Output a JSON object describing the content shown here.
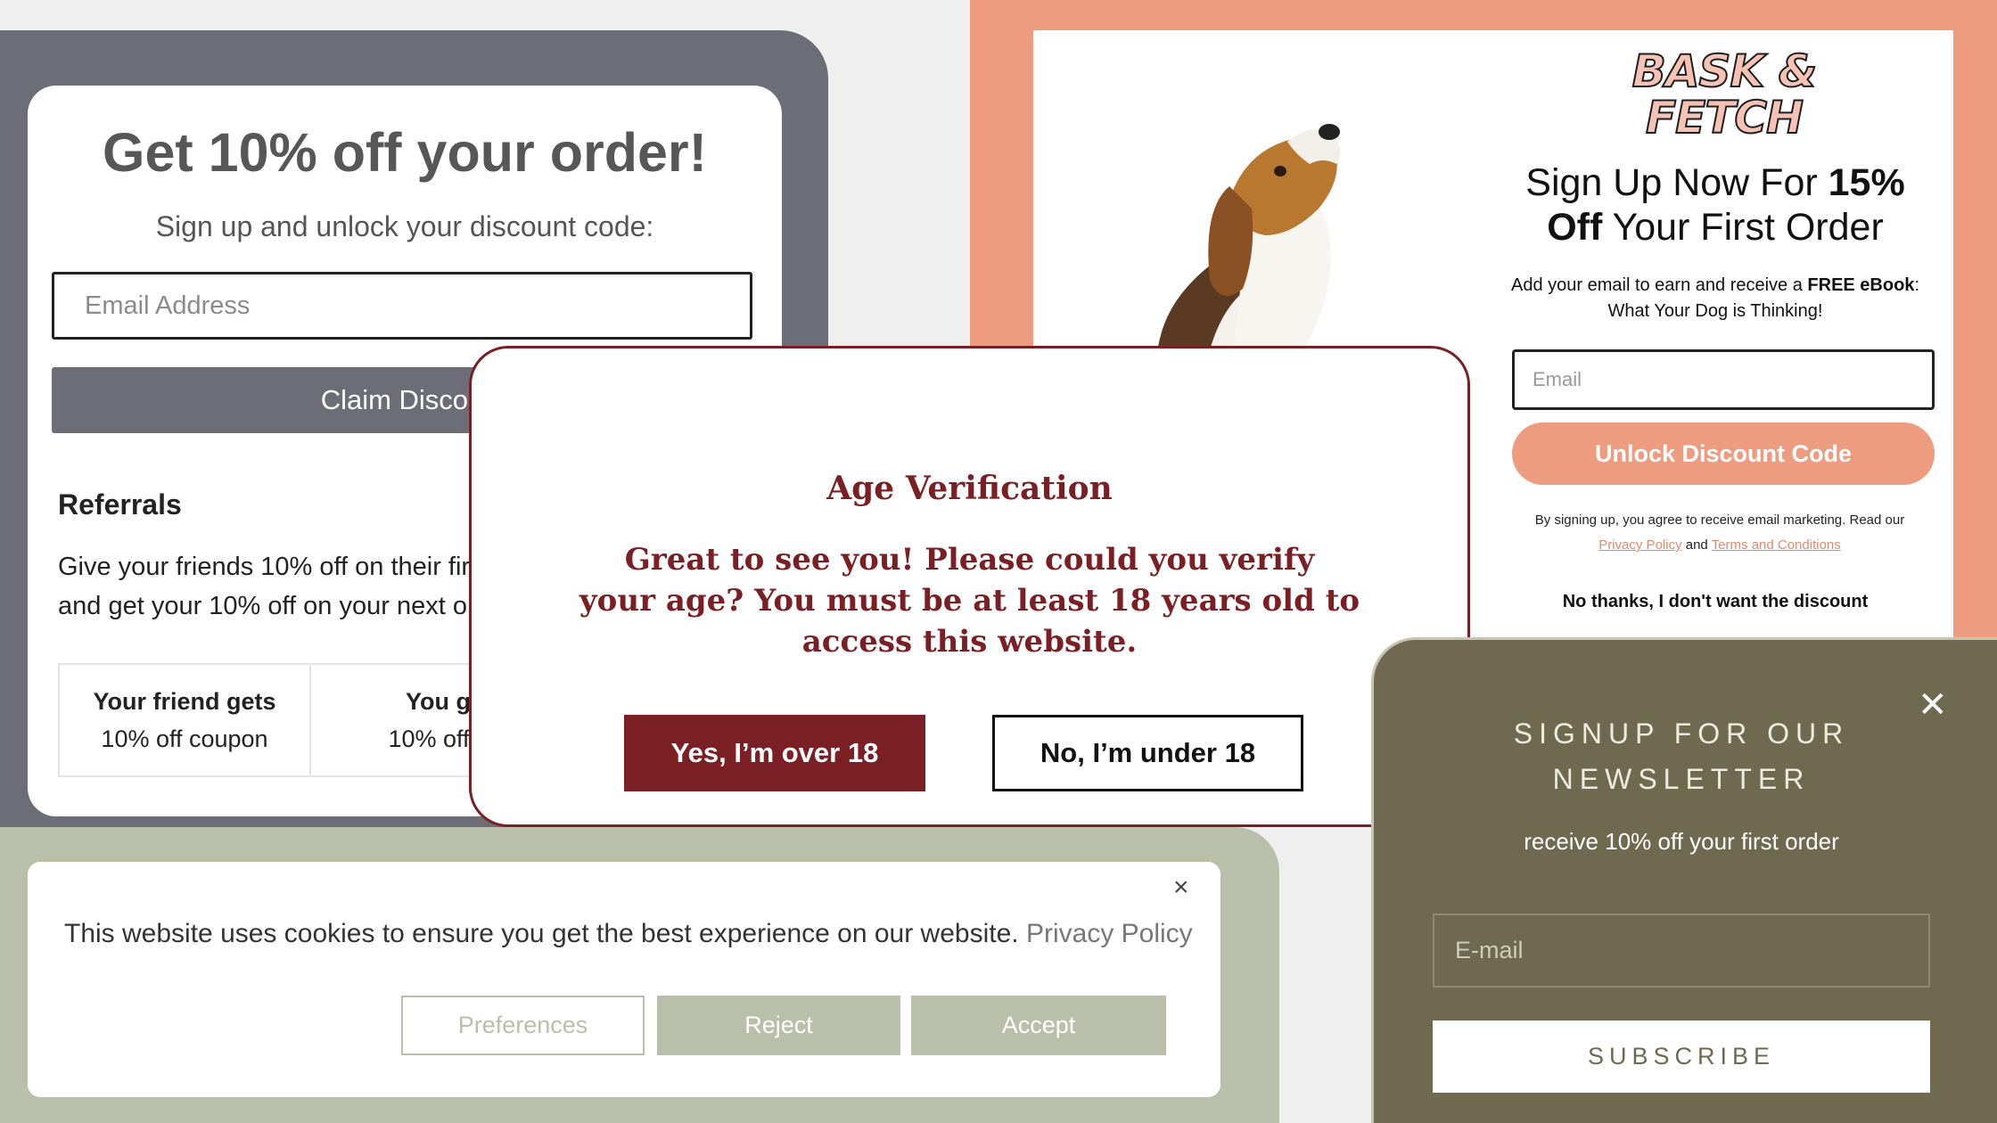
{
  "discount_popup": {
    "title": "Get 10% off your order!",
    "subtitle": "Sign up and unlock your discount code:",
    "email_placeholder": "Email Address",
    "claim_button": "Claim Discou",
    "referrals_title": "Referrals",
    "referrals_line1": "Give your friends 10% off on their fir",
    "referrals_line2": "and get your 10% off on your next or",
    "friend_gets_label": "Your friend gets",
    "friend_gets_value": "10% off coupon",
    "you_get_label": "You ge",
    "you_get_value": "10% off co"
  },
  "bask_fetch": {
    "logo_line1": "BASK &",
    "logo_line2": "FETCH",
    "headline_a": "Sign Up Now For ",
    "headline_b": "15%",
    "headline_c": "Off",
    "headline_d": " Your First Order",
    "desc_a": "Add your email to earn and receive a ",
    "desc_b": "FREE eBook",
    "desc_c": ":",
    "desc_d": "What Your Dog is Thinking!",
    "email_placeholder": "Email",
    "unlock_button": "Unlock Discount Code",
    "terms_text": "By signing up, you agree to receive email marketing. Read our",
    "privacy_link": "Privacy Policy",
    "and_text": "and",
    "terms_link": "Terms and Conditions",
    "no_thanks": "No thanks, I don't want the discount"
  },
  "age_verification": {
    "title": "Age Verification",
    "body_line1": "Great to see you! Please could you verify",
    "body_line2": "your age? You must be at least 18 years old to",
    "body_line3": "access this website.",
    "yes_button": "Yes, I’m over 18",
    "no_button": "No, I’m under 18"
  },
  "cookie_banner": {
    "close": "×",
    "text": "This website uses cookies to ensure you get the best experience on our website.",
    "privacy_link": "Privacy Policy",
    "preferences_button": "Preferences",
    "reject_button": "Reject",
    "accept_button": "Accept"
  },
  "newsletter": {
    "close": "✕",
    "title_line1": "SIGNUP FOR OUR",
    "title_line2": "NEWSLETTER",
    "subtitle": "receive 10% off your first order",
    "email_placeholder": "E-mail",
    "subscribe_button": "SUBSCRIBE"
  },
  "colors": {
    "grey_frame": "#6d6d78",
    "salmon": "#ed9c80",
    "maroon": "#7a1f24",
    "sage": "#b9bfa8",
    "olive": "#6f6a4f"
  }
}
